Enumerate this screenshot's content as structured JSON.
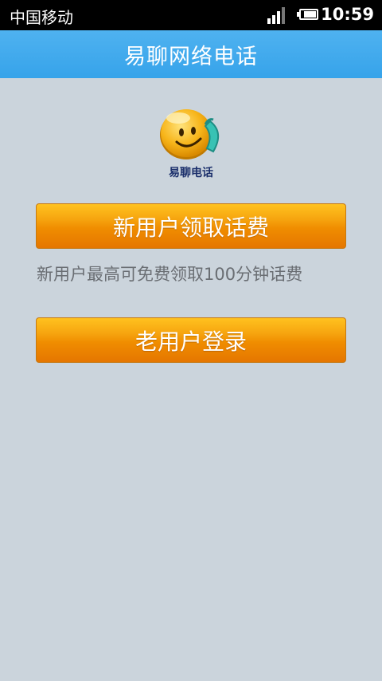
{
  "statusbar": {
    "carrier": "中国移动",
    "time": "10:59",
    "signal_icon": "signal-icon",
    "battery_icon": "battery-icon"
  },
  "header": {
    "title": "易聊网络电话"
  },
  "logo": {
    "text": "易聊电话",
    "icon": "smiley-phone-logo"
  },
  "actions": {
    "new_user_button": "新用户领取话费",
    "new_user_hint": "新用户最高可免费领取100分钟话费",
    "old_user_button": "老用户登录"
  },
  "colors": {
    "titlebar": "#36a3ea",
    "button_orange": "#f08d00",
    "background": "#cbd4dc"
  }
}
